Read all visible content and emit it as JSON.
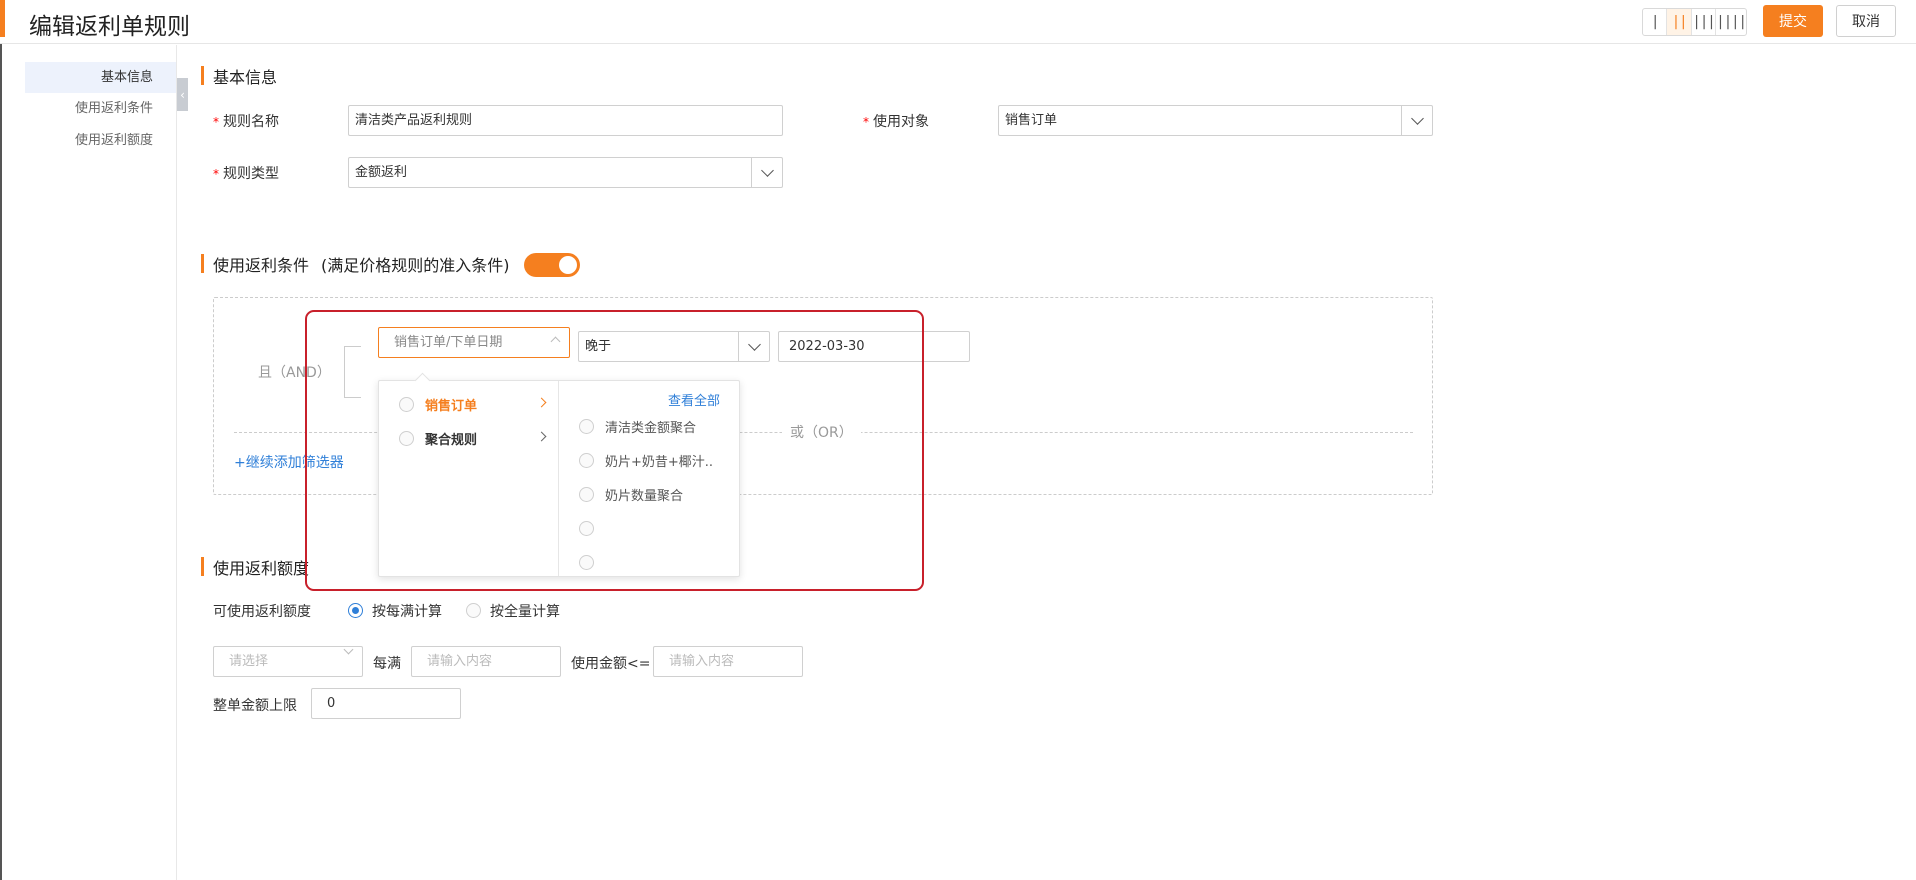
{
  "header": {
    "title": "编辑返利单规则",
    "layout_options": [
      "|",
      "||",
      "|||",
      "||||"
    ],
    "submit_label": "提交",
    "cancel_label": "取消"
  },
  "sidebar": {
    "items": [
      {
        "label": "基本信息",
        "active": true
      },
      {
        "label": "使用返利条件",
        "active": false
      },
      {
        "label": "使用返利额度",
        "active": false
      }
    ],
    "collapse_icon": "‹"
  },
  "basic": {
    "section_title": "基本信息",
    "rule_name_label": "规则名称",
    "rule_name_value": "清洁类产品返利规则",
    "target_label": "使用对象",
    "target_value": "销售订单",
    "rule_type_label": "规则类型",
    "rule_type_value": "金额返利",
    "required_mark": "*"
  },
  "conditions": {
    "section_title": "使用返利条件",
    "section_note": "(满足价格规则的准入条件)",
    "toggle_on": true,
    "and_label": "且（AND）",
    "or_label": "或（OR）",
    "field_value": "销售订单/下单日期",
    "operator_value": "晚于",
    "date_value": "2022-03-30",
    "add_filter_label": "+继续添加筛选器"
  },
  "dropdown": {
    "categories": [
      {
        "label": "销售订单",
        "active": true
      },
      {
        "label": "聚合规则",
        "active": false
      }
    ],
    "view_all_label": "查看全部",
    "options": [
      "清洁类金额聚合",
      "奶片+奶昔+椰汁..",
      "奶片数量聚合",
      "",
      ""
    ]
  },
  "amount": {
    "section_title": "使用返利额度",
    "usable_label": "可使用返利额度",
    "mode_options": [
      {
        "label": "按每满计算",
        "checked": true
      },
      {
        "label": "按全量计算",
        "checked": false
      }
    ],
    "select_placeholder": "请选择",
    "per_full_label": "每满",
    "input_placeholder": "请输入内容",
    "use_amount_label": "使用金额<=",
    "input2_placeholder": "请输入内容",
    "cap_label": "整单金额上限",
    "cap_value": "0"
  }
}
